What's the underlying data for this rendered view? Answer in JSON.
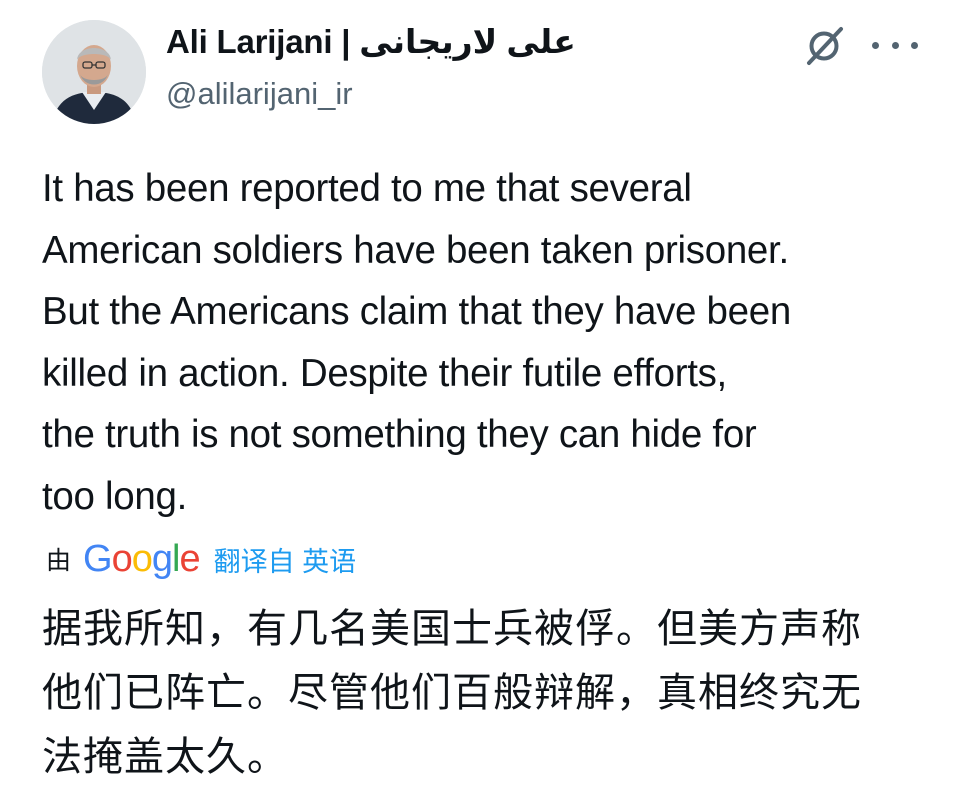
{
  "author": {
    "display_name": "Ali Larijani | علی لاریجانی",
    "handle": "@alilarijani_ir"
  },
  "icons": {
    "avatar": "profile-photo",
    "grok": "grok-icon",
    "more": "more-icon"
  },
  "tweet": {
    "text": "It has been reported to me that several\nAmerican soldiers have been taken prisoner.\nBut the Americans claim that they have been\nkilled in action. Despite their futile efforts,\nthe truth is not something they can hide for\ntoo long."
  },
  "translation": {
    "by_label": "由",
    "provider_logo": "Google",
    "link_text": "翻译自 英语",
    "text": "据我所知，有几名美国士兵被俘。但美方声称\n他们已阵亡。尽管他们百般辩解，真相终究无\n法掩盖太久。"
  },
  "colors": {
    "text": "#0f1419",
    "secondary": "#536471",
    "link": "#1d9bf0",
    "google_blue": "#4285f4",
    "google_red": "#ea4335",
    "google_yellow": "#fbbc05",
    "google_green": "#34a853"
  }
}
